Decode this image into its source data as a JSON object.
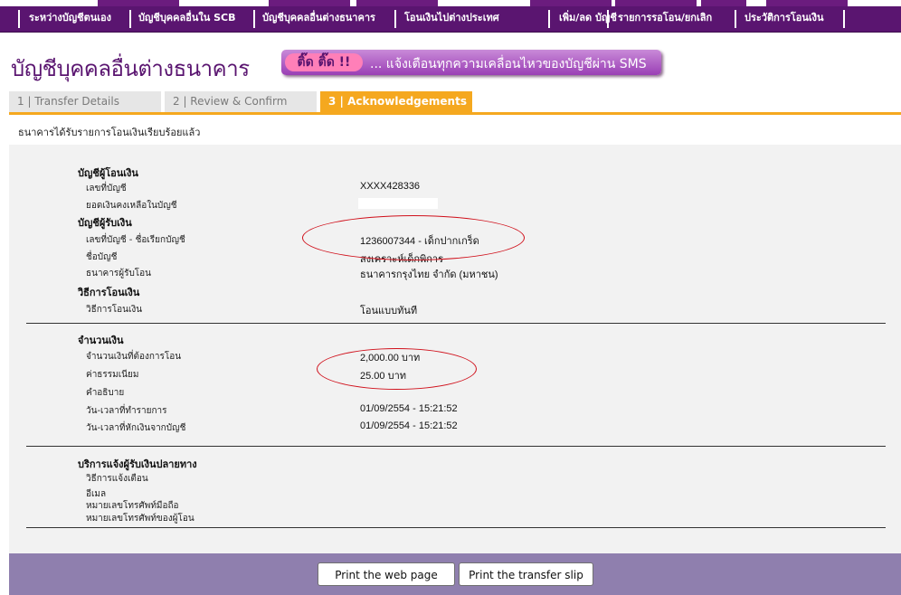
{
  "nav": {
    "items": [
      "ระหว่างบัญชีตนเอง",
      "บัญชีบุคคลอื่นใน SCB",
      "บัญชีบุคคลอื่นต่างธนาคาร",
      "โอนเงินไปต่างประเทศ",
      "เพิ่ม/ลด บัญชี",
      "รายการรอโอน/ยกเลิก",
      "ประวัติการโอนเงิน"
    ]
  },
  "page": {
    "title": "บัญชีบุคคลอื่นต่างธนาคาร",
    "banner_highlight": "ติ๊ด ติ๊ด !!",
    "banner_text": "... แจ้งเตือนทุกความเคลื่อนไหวของบัญชีผ่าน SMS"
  },
  "steps": {
    "step1": "1 | Transfer Details",
    "step2": "2 | Review & Confirm",
    "step3": "3 | Acknowledgements",
    "active": 3
  },
  "status_message": "ธนาคารได้รับรายการโอนเงินเรียบร้อยแล้ว",
  "from_account": {
    "heading": "บัญชีผู้โอนเงิน",
    "account_no_label": "เลขที่บัญชี",
    "account_no": "XXXX428336",
    "balance_label": "ยอดเงินคงเหลือในบัญชี"
  },
  "to_account": {
    "heading": "บัญชีผู้รับเงิน",
    "account_label": "เลขที่บัญชี - ชื่อเรียกบัญชี",
    "account_value": "1236007344 - เด็กปากเกร็ด",
    "name_label": "ชื่อบัญชี",
    "name_value": "สงเคราะห์เด็กพิการ",
    "bank_label": "ธนาคารผู้รับโอน",
    "bank_value": "ธนาคารกรุงไทย จำกัด (มหาชน)"
  },
  "method": {
    "heading": "วิธีการโอนเงิน",
    "label": "วิธีการโอนเงิน",
    "value": "โอนแบบทันที"
  },
  "amount": {
    "heading": "จำนวนเงิน",
    "amount_label": "จำนวนเงินที่ต้องการโอน",
    "amount_value": "2,000.00 บาท",
    "fee_label": "ค่าธรรมเนียม",
    "fee_value": "25.00  บาท",
    "desc_label": "คำอธิบาย",
    "txn_time_label": "วัน-เวลาที่ทำรายการ",
    "txn_time_value": "01/09/2554 - 15:21:52",
    "debit_time_label": "วัน-เวลาที่หักเงินจากบัญชี",
    "debit_time_value": "01/09/2554 - 15:21:52"
  },
  "notify": {
    "heading": "บริการแจ้งผู้รับเงินปลายทาง",
    "method_label": "วิธีการแจ้งเตือน",
    "email_label": "อีเมล",
    "mobile_label": "หมายเลขโทรศัพท์มือถือ",
    "sender_phone_label": "หมายเลขโทรศัพท์ของผู้โอน"
  },
  "buttons": {
    "print_page": "Print the web page",
    "print_slip": "Print the transfer slip"
  },
  "colors": {
    "brand_purple": "#5a1570",
    "tab_active": "#f5a81f",
    "footer": "#8f7fae",
    "annotation_red": "#d0101b"
  }
}
